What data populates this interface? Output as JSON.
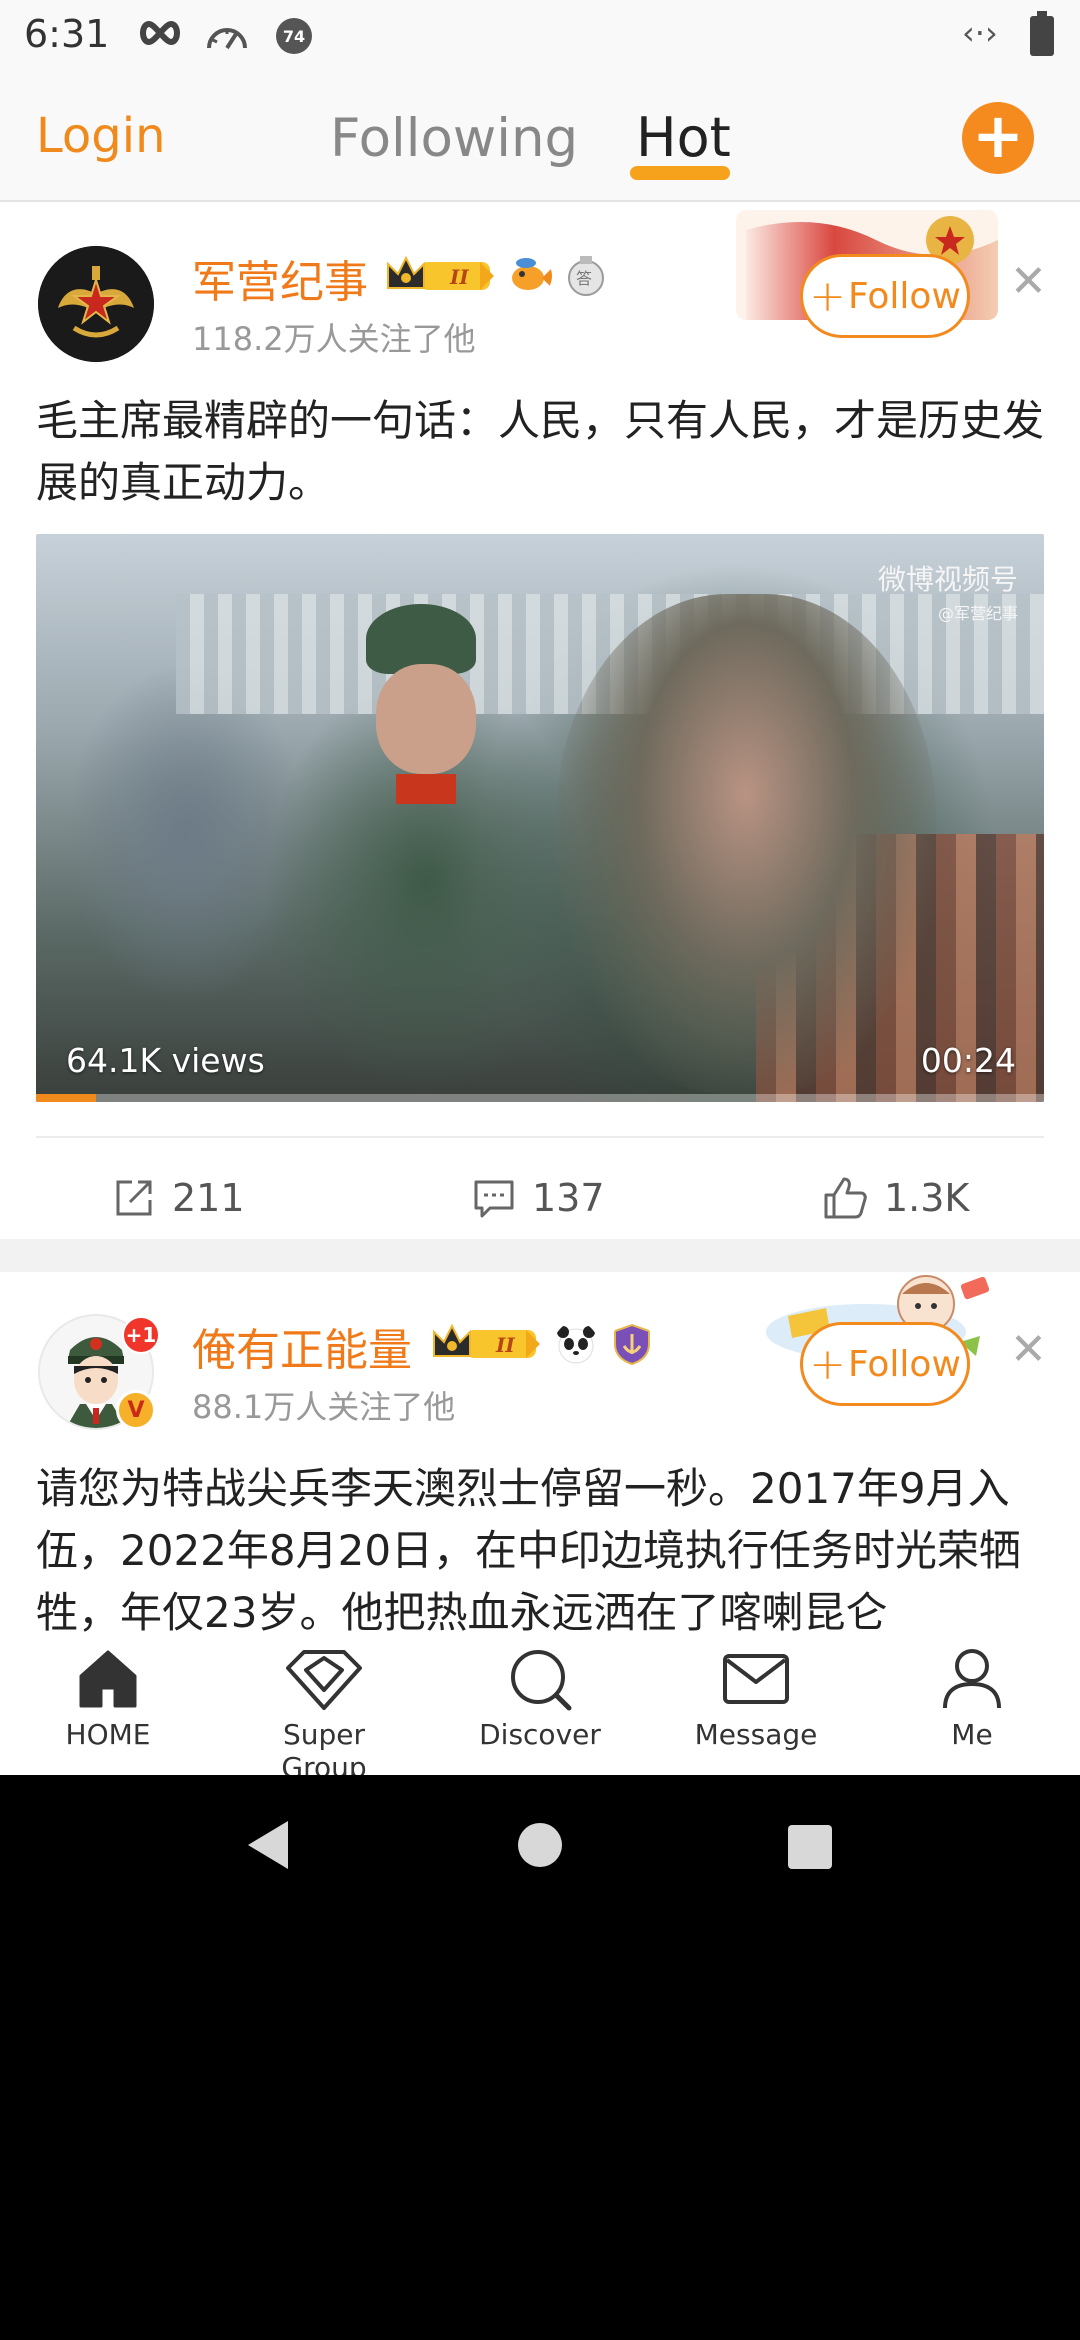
{
  "status_bar": {
    "time": "6:31",
    "notification_badge": "74",
    "data_icon": "‹·›"
  },
  "top_nav": {
    "login": "Login",
    "tabs": [
      {
        "label": "Following",
        "active": false
      },
      {
        "label": "Hot",
        "active": true
      }
    ],
    "compose": "+"
  },
  "posts": [
    {
      "username": "军营纪事",
      "followers": "118.2万人关注了他",
      "follow_label": "Follow",
      "text": "毛主席最精辟的一句话：人民，只有人民，才是历史发展的真正动力。",
      "video": {
        "views": "64.1K views",
        "duration": "00:24",
        "watermark": "微博视频号",
        "watermark_sub": "@军营纪事",
        "progress": 0.06
      },
      "actions": {
        "shares": "211",
        "comments": "137",
        "likes": "1.3K"
      }
    },
    {
      "username": "俺有正能量",
      "followers": "88.1万人关注了他",
      "follow_label": "Follow",
      "avatar_badge": "+1",
      "text": "请您为特战尖兵李天澳烈士停留一秒。2017年9月入伍，2022年8月20日，在中印边境执行任务时光荣牺牲，年仅23岁。他把热血永远洒在了喀喇昆仑"
    }
  ],
  "tab_bar": [
    {
      "label": "HOME",
      "icon": "home-icon"
    },
    {
      "label": "Super Group",
      "icon": "diamond-icon"
    },
    {
      "label": "Discover",
      "icon": "search-icon"
    },
    {
      "label": "Message",
      "icon": "envelope-icon"
    },
    {
      "label": "Me",
      "icon": "person-icon"
    }
  ],
  "colors": {
    "accent": "#f58b1f",
    "username": "#f07a1a",
    "underline": "#f7a21c"
  }
}
